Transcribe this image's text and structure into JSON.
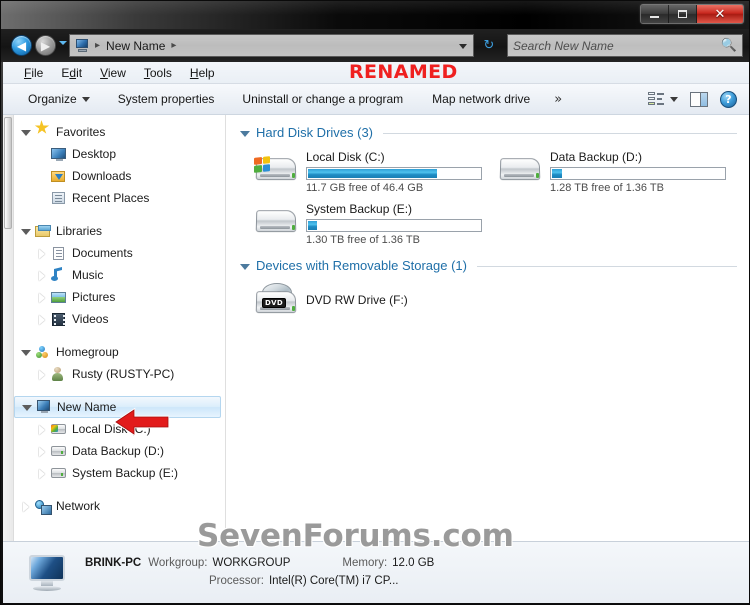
{
  "window": {
    "titlebar": {
      "minimize_label": "Minimize",
      "maximize_label": "Maximize",
      "close_label": "✕"
    }
  },
  "addressbar": {
    "back_label": "◀",
    "forward_label": "▶",
    "recent_label": "Recent pages",
    "pc_icon": "computer-icon",
    "crumb": "New Name",
    "crumb_sep_1": "▸",
    "crumb_sep_2": "▸",
    "refresh_label": "↻",
    "search_placeholder": "Search New Name",
    "search_icon": "search-icon"
  },
  "menubar": {
    "items": [
      {
        "pre": "F",
        "mnemonic": "",
        "label": "File",
        "m_idx": 0
      },
      {
        "label": "Edit"
      },
      {
        "label": "View"
      },
      {
        "label": "Tools"
      },
      {
        "label": "Help"
      }
    ],
    "file": "File",
    "edit": "Edit",
    "view": "View",
    "tools": "Tools",
    "help": "Help"
  },
  "annotation": {
    "renamed_label": "RENAMED",
    "renamed_color": "#ef2020",
    "arrow_color": "#e21b1b",
    "arrow_name": "red-callout-arrow"
  },
  "toolbar": {
    "organize": "Organize",
    "system_properties": "System properties",
    "uninstall": "Uninstall or change a program",
    "map_network_drive": "Map network drive",
    "more": "»",
    "view_icon": "view-options-icon",
    "preview_icon": "preview-pane-icon",
    "help_icon": "help-icon",
    "help_glyph": "?"
  },
  "navpane": {
    "items": [
      {
        "label": "Favorites",
        "level": 1,
        "twisty": "open",
        "icon": "star-icon",
        "icon_class": "ic-star"
      },
      {
        "label": "Desktop",
        "level": 2,
        "twisty": "none",
        "icon": "desktop-icon",
        "icon_class": "ic-desktop"
      },
      {
        "label": "Downloads",
        "level": 2,
        "twisty": "none",
        "icon": "downloads-icon",
        "icon_class": "ic-dl"
      },
      {
        "label": "Recent Places",
        "level": 2,
        "twisty": "none",
        "icon": "recent-places-icon",
        "icon_class": "ic-recent"
      },
      {
        "label": "Libraries",
        "level": 1,
        "twisty": "open",
        "icon": "libraries-icon",
        "icon_class": "ic-lib"
      },
      {
        "label": "Documents",
        "level": 2,
        "twisty": "closed",
        "icon": "documents-icon",
        "icon_class": "ic-doc"
      },
      {
        "label": "Music",
        "level": 2,
        "twisty": "closed",
        "icon": "music-icon",
        "icon_class": "ic-music"
      },
      {
        "label": "Pictures",
        "level": 2,
        "twisty": "closed",
        "icon": "pictures-icon",
        "icon_class": "ic-pic"
      },
      {
        "label": "Videos",
        "level": 2,
        "twisty": "closed",
        "icon": "videos-icon",
        "icon_class": "ic-vid"
      },
      {
        "label": "Homegroup",
        "level": 1,
        "twisty": "open",
        "icon": "homegroup-icon",
        "icon_class": "ic-hg"
      },
      {
        "label": "Rusty (RUSTY-PC)",
        "level": 2,
        "twisty": "closed",
        "icon": "user-icon",
        "icon_class": "ic-user"
      },
      {
        "label": "New Name",
        "level": 1,
        "twisty": "open",
        "icon": "computer-icon",
        "icon_class": "ic-pc",
        "selected": true
      },
      {
        "label": "Local Disk (C:)",
        "level": 2,
        "twisty": "closed",
        "icon": "hard-drive-windows-icon",
        "icon_class": "ic-hdd-win"
      },
      {
        "label": "Data Backup (D:)",
        "level": 2,
        "twisty": "closed",
        "icon": "hard-drive-icon",
        "icon_class": "ic-hdd"
      },
      {
        "label": "System Backup (E:)",
        "level": 2,
        "twisty": "closed",
        "icon": "hard-drive-icon",
        "icon_class": "ic-hdd"
      },
      {
        "label": "Network",
        "level": 1,
        "twisty": "closed",
        "icon": "network-icon",
        "icon_class": "ic-net"
      }
    ]
  },
  "filepane": {
    "groups": [
      {
        "title": "Hard Disk Drives (3)",
        "items": [
          {
            "name": "Local Disk (C:)",
            "capacity_text": "11.7 GB free of 46.4 GB",
            "used_percent": 75,
            "icon": "hard-drive-windows-icon",
            "has_windows_badge": true,
            "has_bar": true
          },
          {
            "name": "Data Backup (D:)",
            "capacity_text": "1.28 TB free of 1.36 TB",
            "used_percent": 6,
            "icon": "hard-drive-icon",
            "has_windows_badge": false,
            "has_bar": true
          },
          {
            "name": "System Backup (E:)",
            "capacity_text": "1.30 TB free of 1.36 TB",
            "used_percent": 5,
            "icon": "hard-drive-icon",
            "has_windows_badge": false,
            "has_bar": true
          }
        ]
      },
      {
        "title": "Devices with Removable Storage (1)",
        "items": [
          {
            "name": "DVD RW Drive (F:)",
            "capacity_text": "",
            "used_percent": 0,
            "icon": "dvd-drive-icon",
            "dvd_label": "DVD",
            "has_windows_badge": false,
            "has_bar": false
          }
        ]
      }
    ]
  },
  "detailspane": {
    "computer_icon": "computer-monitor-icon",
    "computer_name": "BRINK-PC",
    "workgroup_key": "Workgroup:",
    "workgroup_value": "WORKGROUP",
    "memory_key": "Memory:",
    "memory_value": "12.0 GB",
    "processor_key": "Processor:",
    "processor_value": "Intel(R) Core(TM) i7 CP..."
  },
  "watermark": {
    "text": "SevenForums.com"
  },
  "colors": {
    "accent_blue": "#1f6fa8",
    "bar_fill": "#2f9fd6",
    "close_red": "#c9261c",
    "annotation_red": "#ef2020"
  }
}
